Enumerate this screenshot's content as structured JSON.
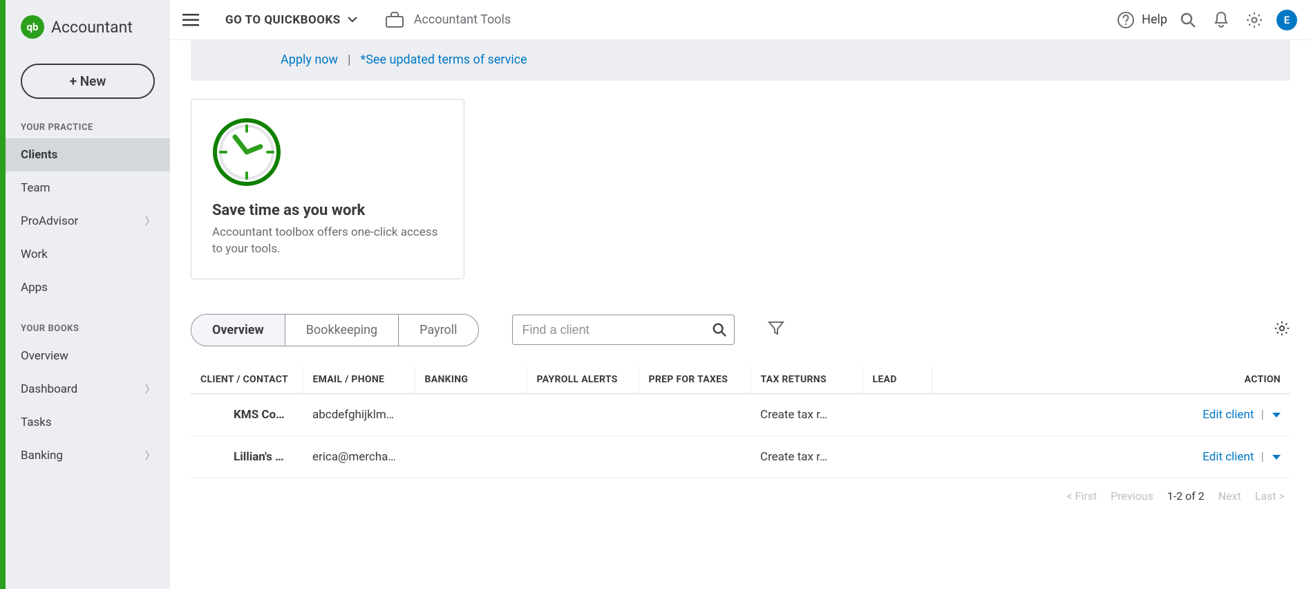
{
  "brand": "Accountant",
  "qb_glyph": "qb",
  "new_button": "+   New",
  "sidebar": {
    "practice_label": "YOUR PRACTICE",
    "books_label": "YOUR BOOKS",
    "practice_items": [
      {
        "label": "Clients",
        "expand": false,
        "active": true
      },
      {
        "label": "Team",
        "expand": false,
        "active": false
      },
      {
        "label": "ProAdvisor",
        "expand": true,
        "active": false
      },
      {
        "label": "Work",
        "expand": false,
        "active": false
      },
      {
        "label": "Apps",
        "expand": false,
        "active": false
      }
    ],
    "books_items": [
      {
        "label": "Overview",
        "expand": false
      },
      {
        "label": "Dashboard",
        "expand": true
      },
      {
        "label": "Tasks",
        "expand": false
      },
      {
        "label": "Banking",
        "expand": true
      }
    ]
  },
  "topbar": {
    "go_to": "GO TO QUICKBOOKS",
    "tools": "Accountant Tools",
    "help": "Help",
    "avatar_initial": "E"
  },
  "banner": {
    "apply": "Apply now",
    "terms": "*See updated terms of service"
  },
  "card": {
    "title": "Save time as you work",
    "body": "Accountant toolbox offers one-click access to your tools."
  },
  "tabs": {
    "overview": "Overview",
    "bookkeeping": "Bookkeeping",
    "payroll": "Payroll"
  },
  "search_placeholder": "Find a client",
  "table": {
    "headers": {
      "client": "CLIENT / CONTACT",
      "email": "EMAIL / PHONE",
      "banking": "BANKING",
      "payroll": "PAYROLL ALERTS",
      "prep": "PREP FOR TAXES",
      "returns": "TAX RETURNS",
      "lead": "LEAD",
      "action": "ACTION"
    },
    "rows": [
      {
        "client": "KMS Co…",
        "email": "abcdefghijklm…",
        "tax": "Create tax r…",
        "action": "Edit client"
      },
      {
        "client": "Lillian's …",
        "email": "erica@mercha…",
        "tax": "Create tax r…",
        "action": "Edit client"
      }
    ]
  },
  "pager": {
    "first": "< First",
    "prev": "Previous",
    "range": "1-2 of 2",
    "next": "Next",
    "last": "Last >"
  }
}
